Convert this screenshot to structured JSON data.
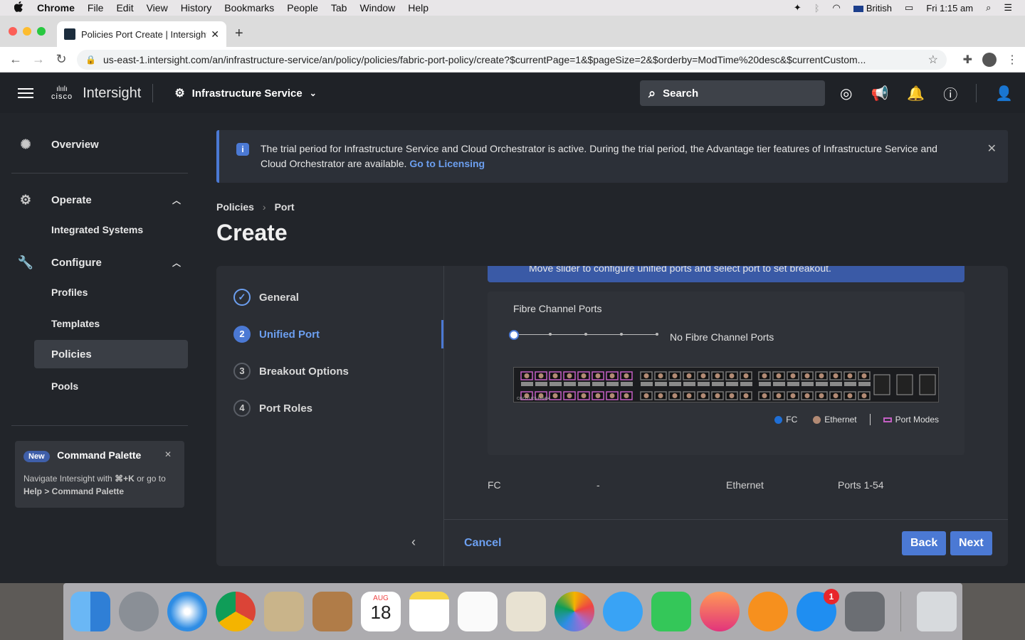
{
  "menubar": {
    "apple": "",
    "items": [
      "Chrome",
      "File",
      "Edit",
      "View",
      "History",
      "Bookmarks",
      "People",
      "Tab",
      "Window",
      "Help"
    ],
    "input_source": "British",
    "clock": "Fri 1:15 am"
  },
  "browser": {
    "tab_title": "Policies Port Create | Intersight",
    "url": "us-east-1.intersight.com/an/infrastructure-service/an/policy/policies/fabric-port-policy/create?$currentPage=1&$pageSize=2&$orderby=ModTime%20desc&$currentCustom..."
  },
  "header": {
    "logo_text": "cisco",
    "brand": "Intersight",
    "service": "Infrastructure Service",
    "search_label": "Search"
  },
  "sidebar": {
    "overview": "Overview",
    "operate": "Operate",
    "integrated_systems": "Integrated Systems",
    "configure": "Configure",
    "profiles": "Profiles",
    "templates": "Templates",
    "policies": "Policies",
    "pools": "Pools",
    "command_palette": {
      "badge": "New",
      "title": "Command Palette",
      "desc_prefix": "Navigate Intersight with ",
      "shortcut": "⌘+K",
      "desc_middle": " or go to ",
      "desc_path": "Help > Command Palette"
    }
  },
  "banner": {
    "text": "The trial period for Infrastructure Service and Cloud Orchestrator is active. During the trial period, the Advantage tier features of Infrastructure Service and Cloud Orchestrator are available.",
    "link": "Go to Licensing"
  },
  "breadcrumb": {
    "root": "Policies",
    "current": "Port"
  },
  "page_title": "Create",
  "steps": [
    {
      "num": "",
      "label": "General"
    },
    {
      "num": "2",
      "label": "Unified Port"
    },
    {
      "num": "3",
      "label": "Breakout Options"
    },
    {
      "num": "4",
      "label": "Port Roles"
    }
  ],
  "unified_port": {
    "hint": "Move slider to configure unified ports and select port to set breakout.",
    "fc_ports_label": "Fibre Channel Ports",
    "slider_value_text": "No Fibre Channel Ports",
    "switch_model": "CISCO UCS-FI-6454",
    "legend": {
      "fc": "FC",
      "ethernet": "Ethernet",
      "port_modes": "Port Modes"
    },
    "summary": {
      "fc_label": "FC",
      "fc_value": "-",
      "eth_label": "Ethernet",
      "eth_value": "Ports 1-54"
    }
  },
  "footer": {
    "cancel": "Cancel",
    "back": "Back",
    "next": "Next"
  },
  "dock": {
    "calendar_month": "AUG",
    "calendar_day": "18",
    "app_store_badge": "1"
  },
  "colors": {
    "accent": "#4b79d4",
    "fc": "#1f6fd6",
    "ethernet": "#b28a74",
    "port_modes": "#c35fc3"
  }
}
